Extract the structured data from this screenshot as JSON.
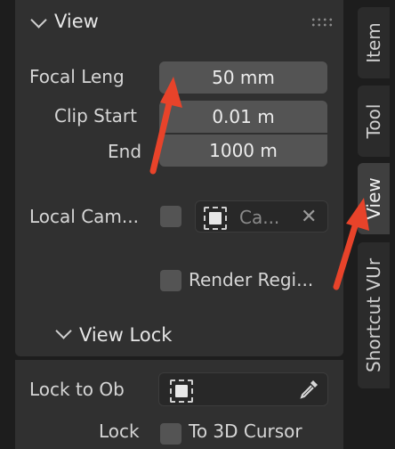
{
  "section": {
    "title": "View"
  },
  "fields": {
    "focal_length": {
      "label": "Focal Leng",
      "value": "50 mm"
    },
    "clip_start": {
      "label": "Clip Start",
      "value": "0.01 m"
    },
    "clip_end": {
      "label": "End",
      "value": "1000 m"
    }
  },
  "local_camera": {
    "label": "Local Cam...",
    "placeholder": "Ca..."
  },
  "render_region": {
    "label": "Render Regi..."
  },
  "view_lock": {
    "title": "View Lock",
    "lock_to_object_label": "Lock to Ob",
    "lock_label": "Lock",
    "to_3d_cursor_label": "To 3D Cursor"
  },
  "tabs": [
    {
      "label": "Item"
    },
    {
      "label": "Tool"
    },
    {
      "label": "View"
    },
    {
      "label": "Shortcut VUr"
    }
  ],
  "colors": {
    "arrow": "#e8432a",
    "panel": "#303030",
    "field": "#545454"
  }
}
